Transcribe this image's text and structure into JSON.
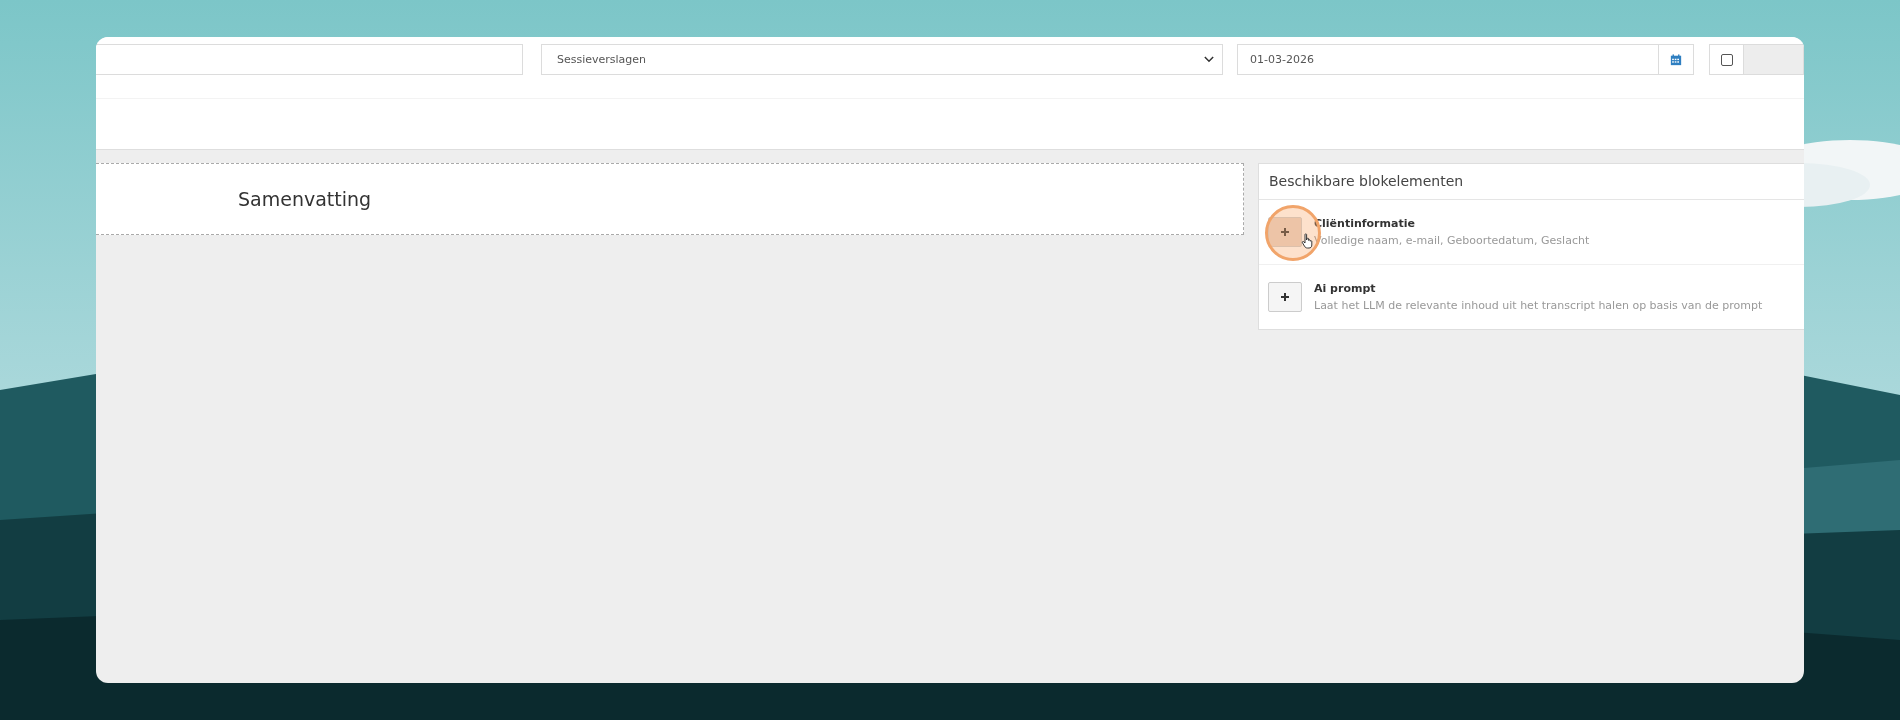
{
  "toolbar": {
    "type_select": {
      "value": "Sessieverslagen"
    },
    "start_date": {
      "value": "01-03-2026"
    },
    "end_date_checkbox": {
      "checked": false
    }
  },
  "template_blocks": [
    {
      "title": "Samenvatting"
    }
  ],
  "available_blocks": {
    "title": "Beschikbare blokelementen",
    "items": [
      {
        "name": "Cliëntinformatie",
        "description": "Volledige naam, e-mail, Geboortedatum, Geslacht",
        "hovered": true
      },
      {
        "name": "Ai prompt",
        "description": "Laat het LLM de relevante inhoud uit het transcript halen op basis van de prompt",
        "hovered": false
      }
    ]
  }
}
